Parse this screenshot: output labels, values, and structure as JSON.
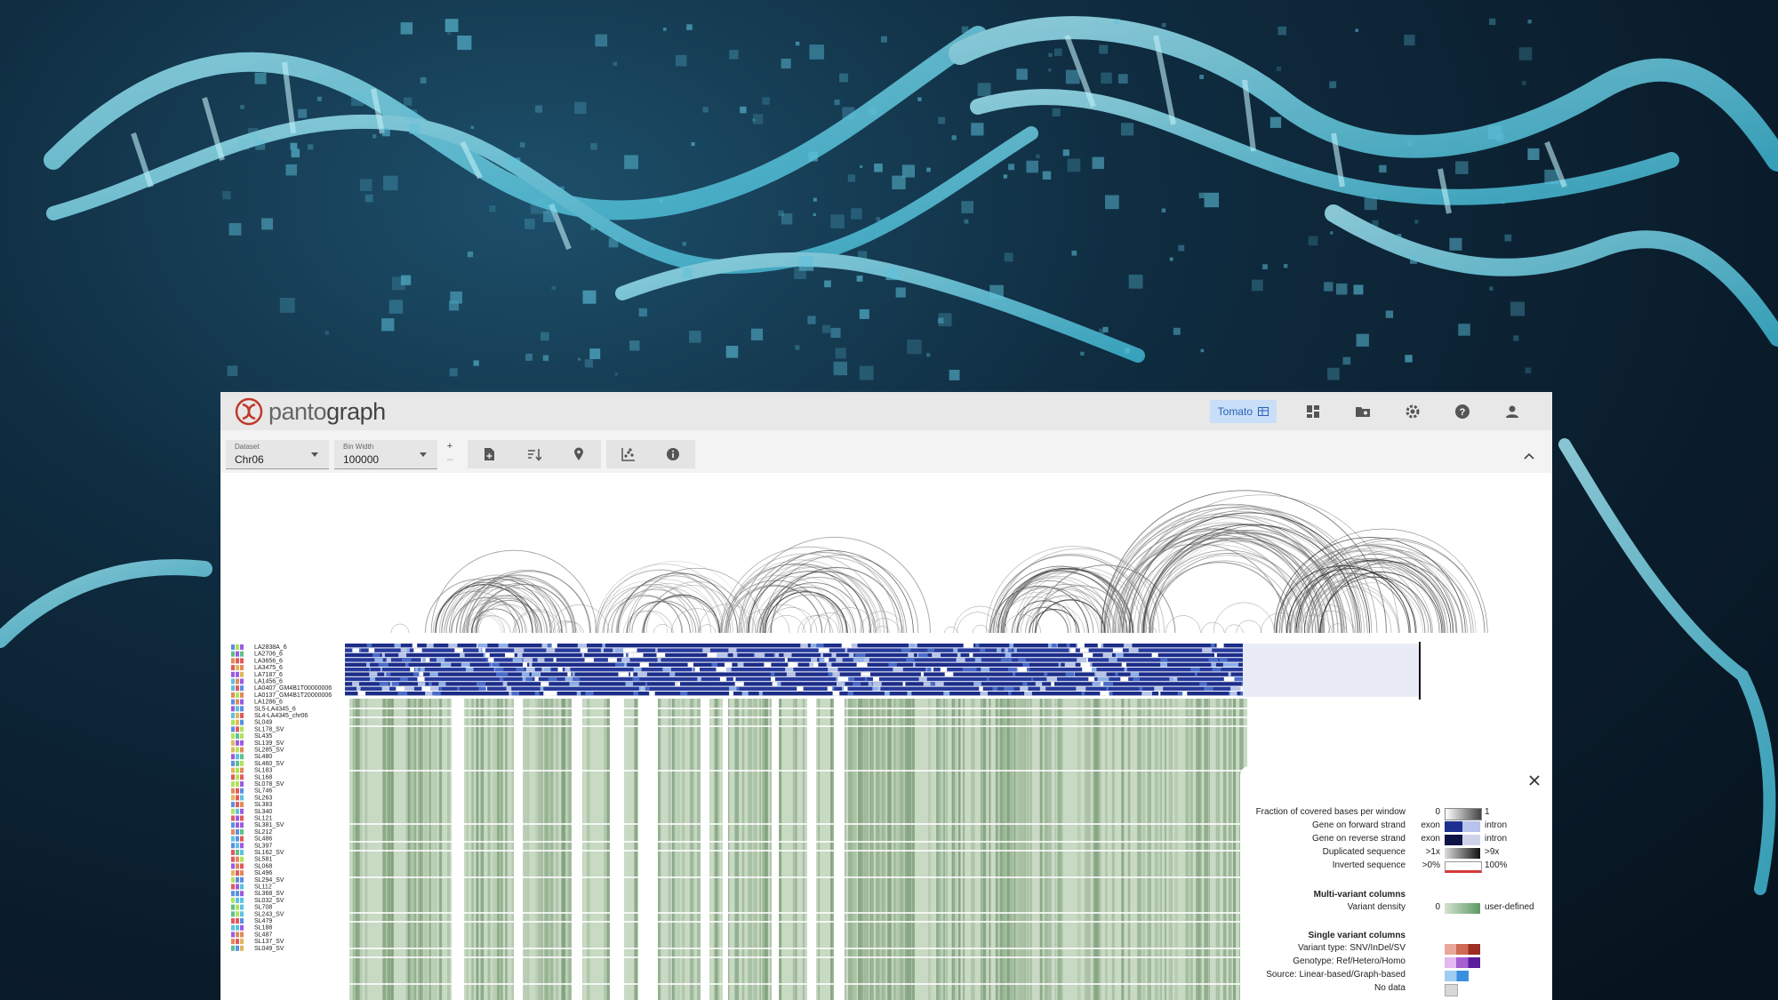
{
  "app": {
    "name_part1": "panto",
    "name_part2": "graph",
    "species_button": "Tomato",
    "brand_color": "#c0392b",
    "icons": [
      "dashboard-icon",
      "folder-icon",
      "settings-icon",
      "help-icon",
      "account-icon"
    ]
  },
  "toolbar": {
    "dataset_label": "Dataset",
    "dataset_value": "Chr06",
    "binwidth_label": "Bin Width",
    "binwidth_value": "100000",
    "plus": "+",
    "minus": "–",
    "group1_icons": [
      "add-file-icon",
      "sort-vertical-icon",
      "location-pin-icon"
    ],
    "group2_icons": [
      "scatter-chart-icon",
      "info-icon"
    ]
  },
  "accessions": [
    "LA2838A_6",
    "LA2706_6",
    "LA3656_6",
    "LA3475_6",
    "LA7187_6",
    "LA1456_6",
    "LA0407_GM4B1T00000006",
    "LA0137_GM4B1T20000006",
    "LA1286_6",
    "SL5-LA4345_6",
    "SL4-LA4345_chr06",
    "SL049",
    "SL178_SV",
    "SL435",
    "SL139_SV",
    "SL285_SV",
    "SL480",
    "SL460_SV",
    "SL183",
    "SL168",
    "SL078_SV",
    "SL746",
    "SL263",
    "SL383",
    "SL340",
    "SL121",
    "SL381_SV",
    "SL212",
    "SL486",
    "SL397",
    "SL162_SV",
    "SL581",
    "SL068",
    "SL496",
    "SL294_SV",
    "SL112",
    "SL368_SV",
    "SL032_SV",
    "SL708",
    "SL243_SV",
    "SL479",
    "SL188",
    "SL487",
    "SL137_SV",
    "SL049_SV"
  ],
  "legend": {
    "rows": [
      {
        "label": "Fraction of covered bases per window",
        "min": "0",
        "max": "1"
      },
      {
        "label": "Gene on forward strand",
        "min": "exon",
        "max": "intron"
      },
      {
        "label": "Gene on reverse strand",
        "min": "exon",
        "max": "intron"
      },
      {
        "label": "Duplicated sequence",
        "min": ">1x",
        "max": ">9x"
      },
      {
        "label": "Inverted sequence",
        "min": ">0%",
        "max": "100%"
      }
    ],
    "multi_heading": "Multi-variant columns",
    "multi_rows": [
      {
        "label": "Variant density",
        "min": "0",
        "max": "user-defined"
      }
    ],
    "single_heading": "Single variant columns",
    "single_rows": [
      {
        "label": "Variant type: SNV/InDel/SV"
      },
      {
        "label": "Genotype: Ref/Hetero/Homo"
      },
      {
        "label": "Source: Linear-based/Graph-based"
      },
      {
        "label": "No data"
      }
    ]
  }
}
